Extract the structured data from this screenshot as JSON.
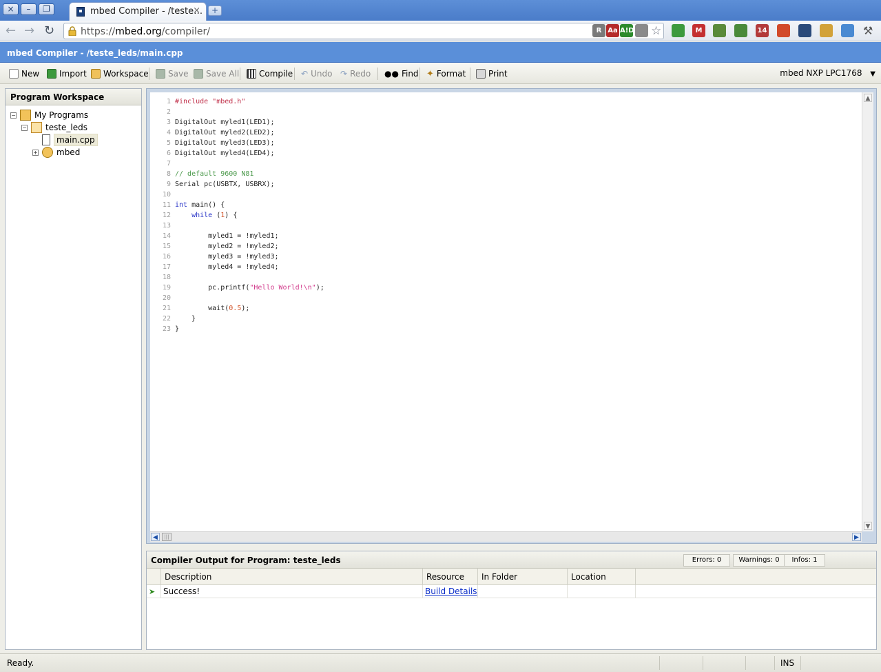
{
  "browser": {
    "tab_title": "mbed Compiler - /teste…",
    "tab_close": "×",
    "new_tab": "+",
    "url_scheme": "https://",
    "url_host": "mbed.org",
    "url_path": "/compiler/",
    "window_buttons": [
      "×",
      "–",
      "❐"
    ],
    "extensions": [
      {
        "name": "readability-icon",
        "label": "R",
        "color": "#7a7a7a"
      },
      {
        "name": "dictionary-icon",
        "label": "Aa",
        "color": "#b52a2a"
      },
      {
        "name": "aid-icon",
        "label": "A!D",
        "color": "#2c8a2c"
      },
      {
        "name": "lightbulb-icon",
        "label": "",
        "color": "#8a8a8a"
      },
      {
        "name": "refresh-ext-icon",
        "label": "",
        "color": "#3d9a3d"
      },
      {
        "name": "gmail-icon",
        "label": "M",
        "color": "#c43030"
      },
      {
        "name": "clip-icon",
        "label": "",
        "color": "#5a8a3a"
      },
      {
        "name": "evernote-icon",
        "label": "",
        "color": "#4a8a3a"
      },
      {
        "name": "feed-icon",
        "label": "14",
        "color": "#b33a3a"
      },
      {
        "name": "popcorn-icon",
        "label": "",
        "color": "#d24a2a"
      },
      {
        "name": "arrows-icon",
        "label": "",
        "color": "#2a4a7a"
      },
      {
        "name": "notepad-icon",
        "label": "",
        "color": "#d2a23a"
      },
      {
        "name": "person-icon",
        "label": "",
        "color": "#4a8ad2"
      }
    ]
  },
  "app": {
    "title": "mbed Compiler - /teste_leds/main.cpp"
  },
  "toolbar": {
    "new": "New",
    "import": "Import",
    "workspace": "Workspace",
    "save": "Save",
    "save_all": "Save All",
    "compile": "Compile",
    "undo": "Undo",
    "redo": "Redo",
    "find": "Find",
    "format": "Format",
    "print": "Print",
    "platform": "mbed NXP LPC1768",
    "platform_arrow": "▼"
  },
  "workspace": {
    "title": "Program Workspace",
    "tree": {
      "root": "My Programs",
      "program": "teste_leds",
      "file": "main.cpp",
      "library": "mbed"
    }
  },
  "editor": {
    "lines": [
      "#include \"mbed.h\"",
      "",
      "DigitalOut myled1(LED1);",
      "DigitalOut myled2(LED2);",
      "DigitalOut myled3(LED3);",
      "DigitalOut myled4(LED4);",
      "",
      "// default 9600 N81",
      "Serial pc(USBTX, USBRX);",
      "",
      "int main() {",
      "    while (1) {",
      "",
      "        myled1 = !myled1;",
      "        myled2 = !myled2;",
      "        myled3 = !myled3;",
      "        myled4 = !myled4;",
      "",
      "        pc.printf(\"Hello World!\\n\");",
      "",
      "        wait(0.5);",
      "    }",
      "}"
    ]
  },
  "output": {
    "title": "Compiler Output for Program: teste_leds",
    "errors": "Errors: 0",
    "warnings": "Warnings: 0",
    "infos": "Infos: 1",
    "columns": [
      "Description",
      "Resource",
      "In Folder",
      "Location"
    ],
    "rows": [
      {
        "description": "Success!",
        "resource": "Build Details",
        "folder": "",
        "location": ""
      }
    ]
  },
  "status": {
    "text": "Ready.",
    "mode": "INS"
  }
}
